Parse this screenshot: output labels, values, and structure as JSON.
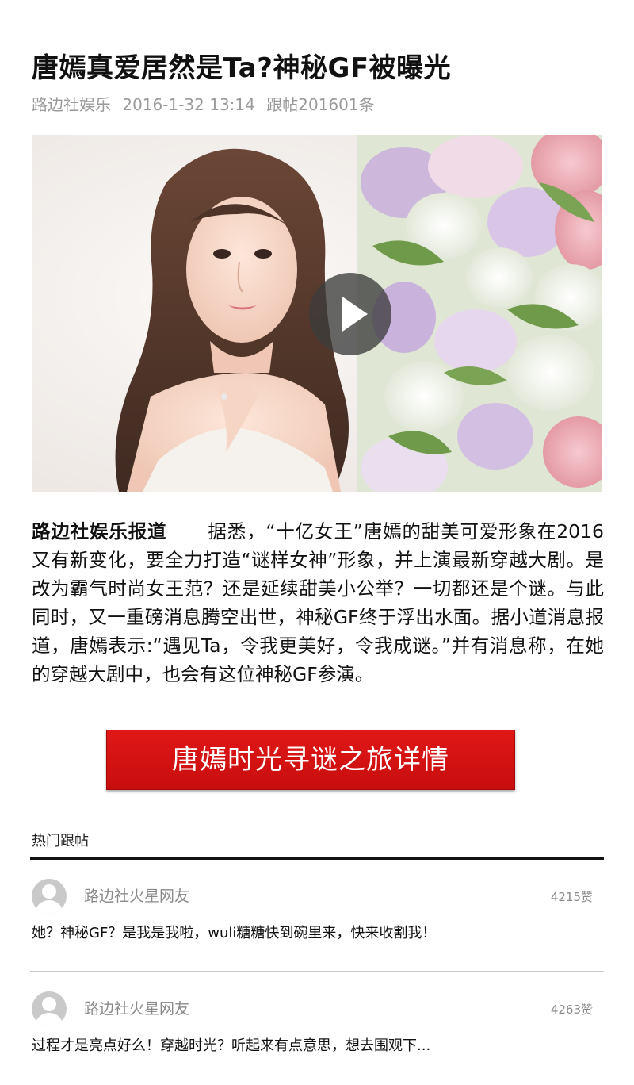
{
  "article": {
    "title": "唐嫣真爱居然是Ta?神秘GF被曝光",
    "source": "路边社娱乐",
    "datetime": "2016-1-32 13:14",
    "followups": "跟帖201601条",
    "lead": "路边社娱乐报道",
    "body": "据悉，“十亿女王”唐嫣的甜美可爱形象在2016又有新变化，要全力打造“谜样女神”形象，并上演最新穿越大剧。是改为霸气时尚女王范？还是延续甜美小公举？一切都还是个谜。与此同时，又一重磅消息腾空出世，神秘GF终于浮出水面。据小道消息报道，唐嫣表示:“遇见Ta，令我更美好，令我成谜。”并有消息称，在她的穿越大剧中，也会有这位神秘GF参演。",
    "cta_label": "唐嫣时光寻谜之旅详情"
  },
  "hero": {
    "media": "video-thumbnail",
    "play_icon": "play-icon"
  },
  "comments_section": {
    "title": "热门跟帖",
    "items": [
      {
        "user": "路边社火星网友",
        "likes": "4215赞",
        "text": "她？神秘GF？是我是我啦，wuli糖糖快到碗里来，快来收割我！"
      },
      {
        "user": "路边社火星网友",
        "likes": "4263赞",
        "text": "过程才是亮点好么！穿越时光？听起来有点意思，想去围观下..."
      }
    ]
  },
  "colors": {
    "cta_background": "#d51212",
    "meta_text": "#9a9a9a",
    "divider": "#c8c8c8"
  }
}
